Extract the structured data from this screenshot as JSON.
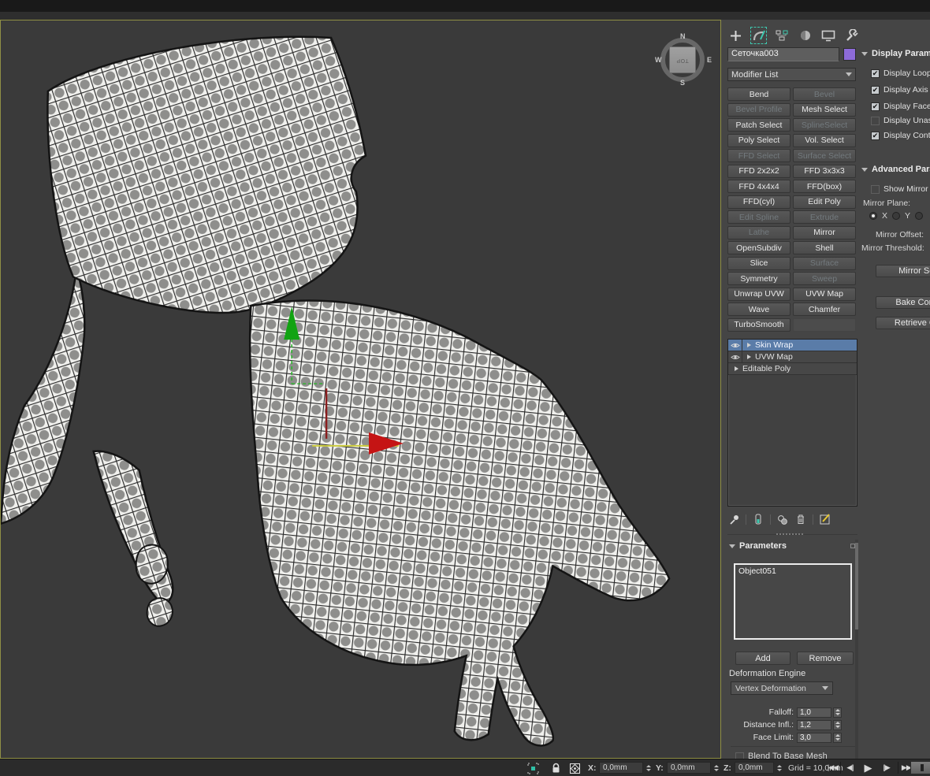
{
  "command_panel": {
    "tabs": [
      "create",
      "modify",
      "hierarchy",
      "motion",
      "display",
      "utilities"
    ],
    "active_tab": "modify",
    "object_name_value": "Сеточка003",
    "modifier_list_label": "Modifier List",
    "modifier_buttons": [
      {
        "label": "Bend",
        "enabled": true
      },
      {
        "label": "Bevel",
        "enabled": false
      },
      {
        "label": "Bevel Profile",
        "enabled": false
      },
      {
        "label": "Mesh Select",
        "enabled": true
      },
      {
        "label": "Patch Select",
        "enabled": true
      },
      {
        "label": "SplineSelect",
        "enabled": false
      },
      {
        "label": "Poly Select",
        "enabled": true
      },
      {
        "label": "Vol. Select",
        "enabled": true
      },
      {
        "label": "FFD Select",
        "enabled": false
      },
      {
        "label": "Surface Select",
        "enabled": false
      },
      {
        "label": "FFD 2x2x2",
        "enabled": true
      },
      {
        "label": "FFD 3x3x3",
        "enabled": true
      },
      {
        "label": "FFD 4x4x4",
        "enabled": true
      },
      {
        "label": "FFD(box)",
        "enabled": true
      },
      {
        "label": "FFD(cyl)",
        "enabled": true
      },
      {
        "label": "Edit Poly",
        "enabled": true
      },
      {
        "label": "Edit Spline",
        "enabled": false
      },
      {
        "label": "Extrude",
        "enabled": false
      },
      {
        "label": "Lathe",
        "enabled": false
      },
      {
        "label": "Mirror",
        "enabled": true
      },
      {
        "label": "OpenSubdiv",
        "enabled": true
      },
      {
        "label": "Shell",
        "enabled": true
      },
      {
        "label": "Slice",
        "enabled": true
      },
      {
        "label": "Surface",
        "enabled": false
      },
      {
        "label": "Symmetry",
        "enabled": true
      },
      {
        "label": "Sweep",
        "enabled": false
      },
      {
        "label": "Unwrap UVW",
        "enabled": true
      },
      {
        "label": "UVW Map",
        "enabled": true
      },
      {
        "label": "Wave",
        "enabled": true
      },
      {
        "label": "Chamfer",
        "enabled": true
      },
      {
        "label": "TurboSmooth",
        "enabled": true
      },
      {
        "label": "",
        "enabled": false
      }
    ],
    "modifier_stack": [
      {
        "label": "Skin Wrap",
        "selected": true,
        "has_eye": true
      },
      {
        "label": "UVW Map",
        "selected": false,
        "has_eye": true
      },
      {
        "label": "Editable Poly",
        "selected": false,
        "has_eye": false
      }
    ],
    "stack_tools": [
      "pin-stack",
      "show-end-result",
      "make-unique",
      "remove-modifier",
      "configure-modifier-sets"
    ],
    "parameters": {
      "title": "Parameters",
      "object_list": [
        "Object051"
      ],
      "add_label": "Add",
      "remove_label": "Remove",
      "deformation_engine_label": "Deformation Engine",
      "deformation_engine_value": "Vertex Deformation",
      "spinners": [
        {
          "label": "Falloff:",
          "value": "1,0"
        },
        {
          "label": "Distance Infl.:",
          "value": "1,2"
        },
        {
          "label": "Face Limit:",
          "value": "3,0"
        }
      ],
      "blend_checkbox_label": "Blend To Base Mesh"
    },
    "display_parameters": {
      "title": "Display Parame",
      "items": [
        {
          "label": "Display Loops",
          "mark": "✔"
        },
        {
          "label": "Display Axis",
          "mark": "✔"
        },
        {
          "label": "Display Face L",
          "mark": "✔"
        },
        {
          "label": "Display Unass",
          "mark": ""
        },
        {
          "label": "Display Contro",
          "mark": "✔"
        }
      ]
    },
    "advanced_parameters": {
      "title": "Advanced Para",
      "show_mirror": {
        "label": "Show Mirror D",
        "mark": ""
      },
      "mirror_plane_label": "Mirror Plane:",
      "radios": [
        {
          "label": "X",
          "selected": true
        },
        {
          "label": "Y",
          "selected": false
        },
        {
          "label": "",
          "selected": false
        }
      ],
      "mirror_offset_label": "Mirror Offset:",
      "mirror_threshold_label": "Mirror Threshold:",
      "buttons": [
        {
          "label": "Mirror Sele"
        },
        {
          "label": "Bake Contro"
        },
        {
          "label": "Retrieve Con"
        }
      ]
    }
  },
  "viewport": {
    "viewcube": {
      "n": "N",
      "e": "E",
      "s": "S",
      "w": "W",
      "face": "TOP"
    },
    "gizmo_axes": [
      "x-red",
      "y-green"
    ]
  },
  "status_bar": {
    "icons": [
      "selection-region",
      "lock-selection",
      "transform-gizmo"
    ],
    "x_label": "X:",
    "x_value": "0,0mm",
    "y_label": "Y:",
    "y_value": "0,0mm",
    "z_label": "Z:",
    "z_value": "0,0mm",
    "grid_text": "Grid = 10,0mm",
    "playback": {
      "start": "|◀◀",
      "prev": "◀||",
      "play": "▶",
      "next": "||▶",
      "end": "▶▶|"
    }
  },
  "colors": {
    "accent_teal": "#3ec9b0",
    "selection_blue": "#5a7ca8",
    "swatch_purple": "#8d6bd8",
    "viewport_border": "#8f8f45",
    "gizmo_green": "#17a317",
    "gizmo_red": "#c51414",
    "panel_bg": "#454545",
    "viewport_bg": "#3a3a3a"
  }
}
